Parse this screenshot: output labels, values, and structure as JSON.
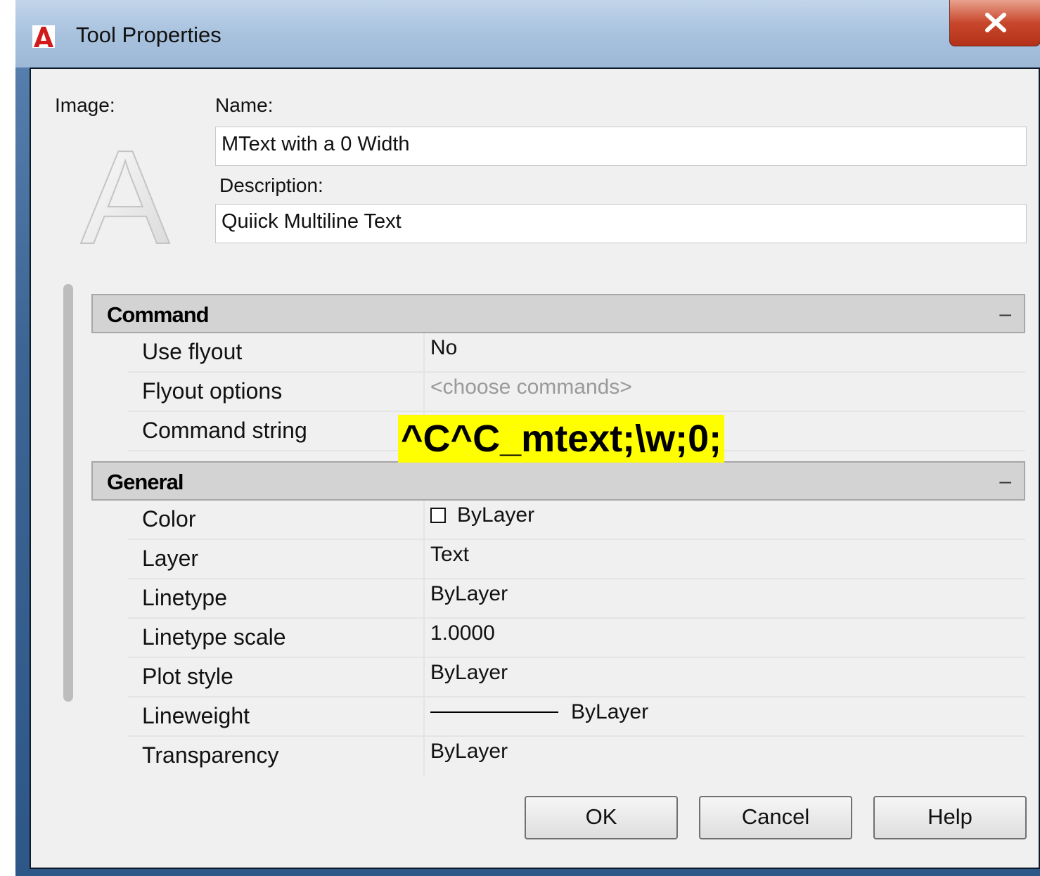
{
  "window": {
    "title": "Tool Properties",
    "close_glyph": "X"
  },
  "labels": {
    "image": "Image:",
    "name": "Name:",
    "description": "Description:"
  },
  "fields": {
    "name": "MText with a 0 Width",
    "description": "Quiick Multiline Text"
  },
  "image_preview": {
    "glyph": "A"
  },
  "sections": [
    {
      "title": "Command",
      "collapse_glyph": "–",
      "rows": [
        {
          "key": "Use flyout",
          "value": "No"
        },
        {
          "key": "Flyout options",
          "value": "<choose commands>"
        },
        {
          "key": "Command string",
          "value": ""
        }
      ]
    },
    {
      "title": "General",
      "collapse_glyph": "–",
      "rows": [
        {
          "key": "Color",
          "value": "ByLayer"
        },
        {
          "key": "Layer",
          "value": "Text"
        },
        {
          "key": "Linetype",
          "value": "ByLayer"
        },
        {
          "key": "Linetype scale",
          "value": "1.0000"
        },
        {
          "key": "Plot style",
          "value": "ByLayer"
        },
        {
          "key": "Lineweight",
          "value": "ByLayer"
        },
        {
          "key": "Transparency",
          "value": "ByLayer"
        }
      ]
    }
  ],
  "highlight_annotation": "^C^C_mtext;\\w;0;",
  "buttons": {
    "ok": "OK",
    "cancel": "Cancel",
    "help": "Help"
  },
  "colors": {
    "highlight": "#ffff00",
    "title_bar": "#a8c2de",
    "close_button": "#c8472c"
  },
  "icons": {
    "app": "autocad-logo-icon",
    "close": "close-icon",
    "color_swatch": "color-swatch-icon"
  }
}
